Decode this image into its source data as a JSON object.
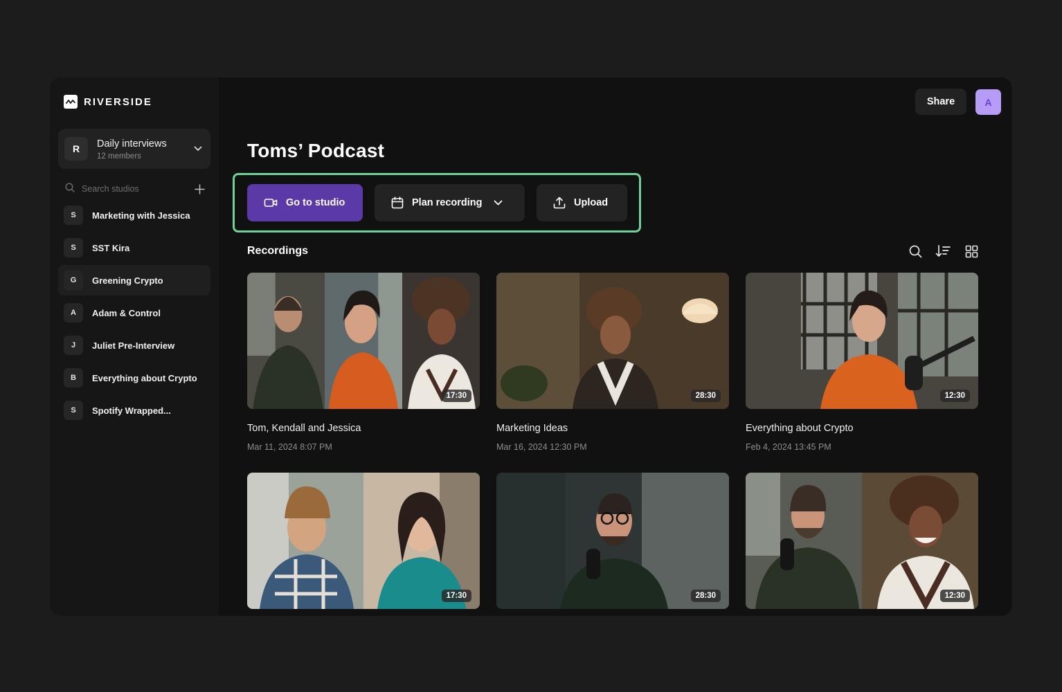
{
  "brand": {
    "name": "RIVERSIDE"
  },
  "workspace": {
    "initial": "R",
    "name": "Daily interviews",
    "members": "12 members"
  },
  "sidebar": {
    "search_placeholder": "Search studios",
    "studios": [
      {
        "initial": "S",
        "name": "Marketing with Jessica"
      },
      {
        "initial": "S",
        "name": "SST Kira"
      },
      {
        "initial": "G",
        "name": "Greening Crypto",
        "active": true
      },
      {
        "initial": "A",
        "name": "Adam & Control"
      },
      {
        "initial": "J",
        "name": "Juliet Pre-Interview"
      },
      {
        "initial": "B",
        "name": "Everything about Crypto"
      },
      {
        "initial": "S",
        "name": "Spotify Wrapped..."
      }
    ]
  },
  "header": {
    "share_label": "Share",
    "avatar_initial": "A"
  },
  "page": {
    "title": "Toms’ Podcast"
  },
  "actions": {
    "studio_label": "Go to studio",
    "plan_label": "Plan recording",
    "upload_label": "Upload"
  },
  "recordings": {
    "title": "Recordings",
    "items": [
      {
        "title": "Tom, Kendall and Jessica",
        "date": "Mar 11, 2024 8:07 PM",
        "duration": "17:30"
      },
      {
        "title": "Marketing Ideas",
        "date": "Mar 16, 2024 12:30 PM",
        "duration": "28:30"
      },
      {
        "title": "Everything about Crypto",
        "date": "Feb 4, 2024 13:45 PM",
        "duration": "12:30"
      },
      {
        "title": "",
        "date": "",
        "duration": "17:30"
      },
      {
        "title": "",
        "date": "",
        "duration": "28:30"
      },
      {
        "title": "",
        "date": "",
        "duration": "12:30"
      }
    ]
  },
  "colors": {
    "accent": "#5b3aa8",
    "highlight_frame": "#6cd49a",
    "avatar": "#b79cf7"
  },
  "icons": {
    "logo": "riverside-logo-icon",
    "chevron": "chevron-down-icon",
    "search": "search-icon",
    "add": "plus-icon",
    "camera": "video-camera-icon",
    "calendar": "calendar-icon",
    "upload": "upload-icon",
    "sort": "sort-icon",
    "grid": "grid-view-icon"
  }
}
